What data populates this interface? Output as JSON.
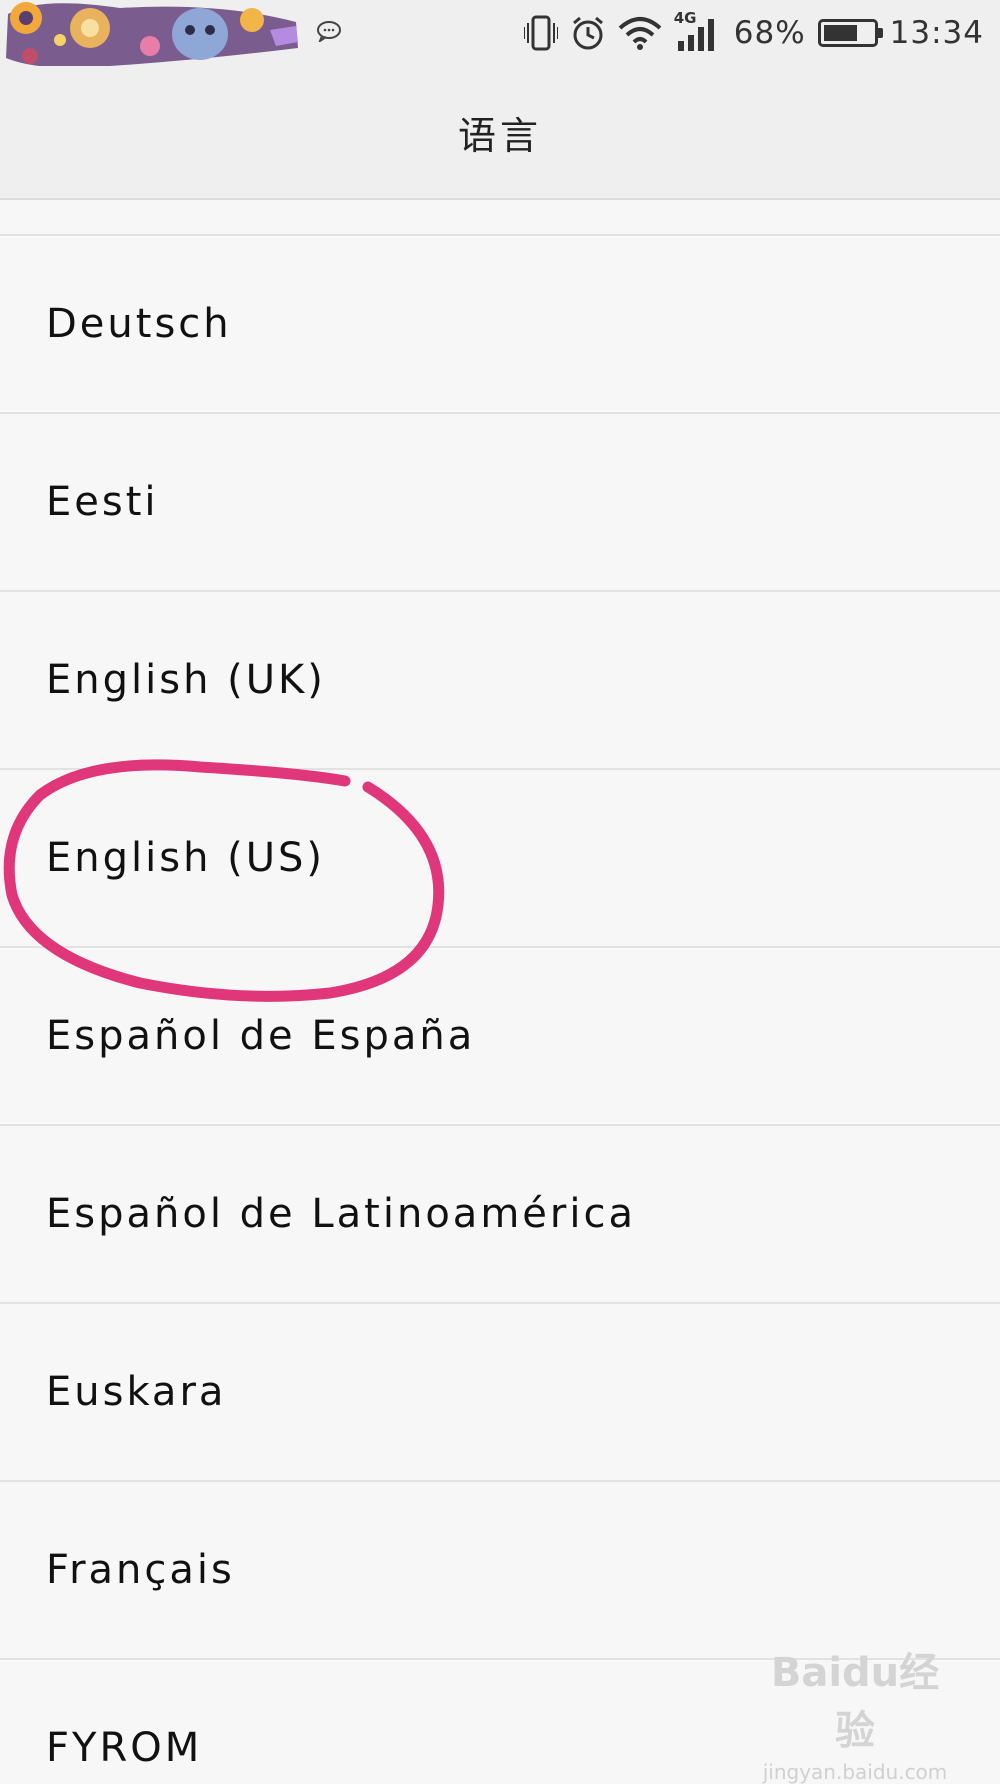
{
  "status_bar": {
    "network": "4G",
    "battery_percent": "68%",
    "battery_level": 0.68,
    "time": "13:34",
    "icons": [
      "notification-art",
      "chat-bubble-icon",
      "vibrate-icon",
      "alarm-icon",
      "wifi-icon",
      "signal-icon",
      "battery-icon"
    ]
  },
  "header": {
    "title": "语言"
  },
  "languages": [
    {
      "label": "Deutsch"
    },
    {
      "label": "Eesti"
    },
    {
      "label": "English (UK)"
    },
    {
      "label": "English (US)",
      "highlighted": true
    },
    {
      "label": "Español de España"
    },
    {
      "label": "Español de Latinoamérica"
    },
    {
      "label": "Euskara"
    },
    {
      "label": "Français"
    },
    {
      "label": "FYROM"
    }
  ],
  "annotation": {
    "color": "#e0377a",
    "target": "English (US)"
  },
  "watermark": {
    "logo": "Baidu经验",
    "site": "jingyan.baidu.com"
  }
}
